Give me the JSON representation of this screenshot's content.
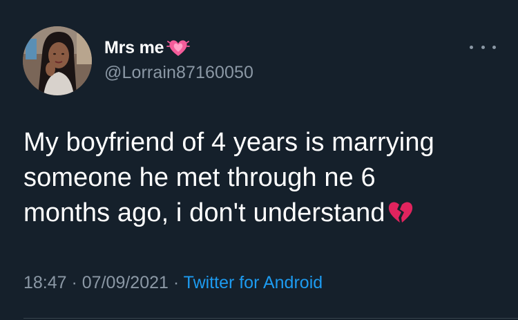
{
  "author": {
    "display_name": "Mrs me",
    "name_emoji": "growing-heart-icon",
    "handle": "@Lorrain87160050",
    "avatar": "avatar-photo"
  },
  "tweet": {
    "lines": [
      "My boyfriend of 4 years is marrying",
      "someone he met through ne 6",
      "months ago, i don't understand"
    ],
    "trailing_emoji": "broken-heart-icon"
  },
  "meta": {
    "time": "18:47",
    "separator1": " · ",
    "date": "07/09/2021",
    "separator2": " · ",
    "source": "Twitter for Android"
  },
  "colors": {
    "background": "#15202b",
    "text": "#ffffff",
    "secondary": "#8b98a5",
    "link": "#1d9bf0",
    "heart": "#f45c9a",
    "broken_heart": "#e0245e"
  }
}
